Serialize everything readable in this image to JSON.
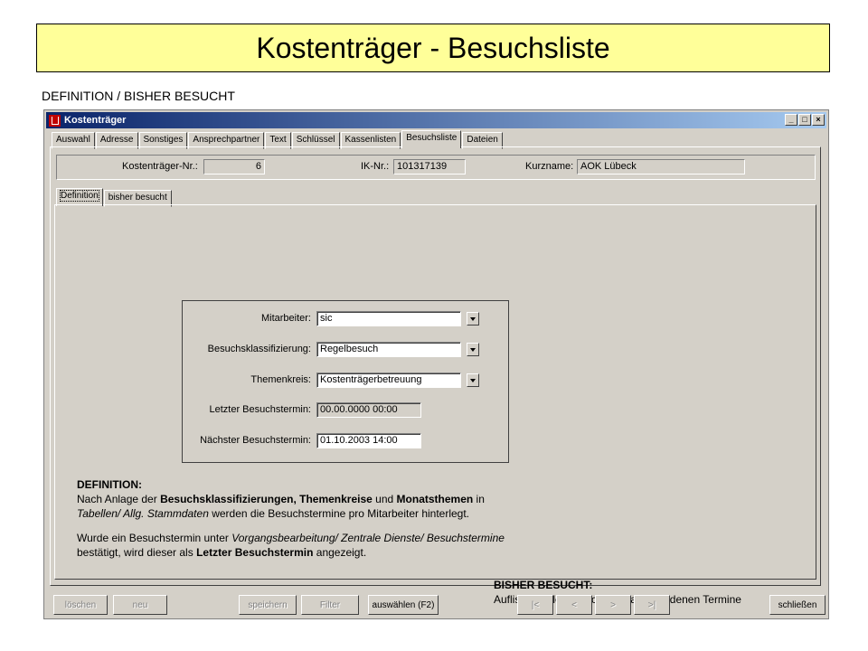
{
  "slide": {
    "title": "Kostenträger - Besuchsliste",
    "subtitle": "DEFINITION / BISHER BESUCHT"
  },
  "window": {
    "title": "Kostenträger",
    "controls": {
      "minimize": "_",
      "maximize": "□",
      "close": "×"
    }
  },
  "tabs": [
    "Auswahl",
    "Adresse",
    "Sonstiges",
    "Ansprechpartner",
    "Text",
    "Schlüssel",
    "Kassenlisten",
    "Besuchsliste",
    "Dateien"
  ],
  "active_tab": "Besuchsliste",
  "header": {
    "kt_nr_label": "Kostenträger-Nr.:",
    "kt_nr_value": "6",
    "ik_nr_label": "IK-Nr.:",
    "ik_nr_value": "101317139",
    "kurzname_label": "Kurzname:",
    "kurzname_value": "AOK Lübeck"
  },
  "subtabs": [
    "Definition",
    "bisher besucht"
  ],
  "form": {
    "mitarbeiter_label": "Mitarbeiter:",
    "mitarbeiter_value": "sic",
    "klass_label": "Besuchsklassifizierung:",
    "klass_value": "Regelbesuch",
    "themen_label": "Themenkreis:",
    "themen_value": "Kostenträgerbetreuung",
    "letzter_label": "Letzter Besuchstermin:",
    "letzter_value": "00.00.0000 00:00",
    "naechster_label": "Nächster Besuchstermin:",
    "naechster_value": "01.10.2003 14:00"
  },
  "definition": {
    "heading": "DEFINITION:",
    "l1_a": "Nach Anlage der ",
    "l1_b": "Besuchsklassifizierungen, Themenkreise",
    "l1_c": " und ",
    "l1_d": "Monatsthemen",
    "l1_e": " in",
    "l2_a": "Tabellen/ Allg. Stammdaten",
    "l2_b": " werden die Besuchstermine pro Mitarbeiter hinterlegt.",
    "l3_a": "Wurde ein Besuchstermin unter ",
    "l3_b": "Vorgangsbearbeitung/ Zentrale Dienste/ Besuchstermine",
    "l4_a": "bestätigt,  wird dieser als ",
    "l4_b": "Letzter Besuchstermin",
    "l4_c": " angezeigt."
  },
  "bisher": {
    "heading": "BISHER BESUCHT:",
    "text": "Auflistung aller tatsächlich stattgefundenen Termine"
  },
  "buttons": {
    "loeschen": "löschen",
    "neu": "neu",
    "speichern": "speichern",
    "filter": "Filter",
    "auswaehlen": "auswählen (F2)",
    "first": "|<",
    "prev": "<",
    "next": ">",
    "last": ">|",
    "schliessen": "schließen"
  }
}
